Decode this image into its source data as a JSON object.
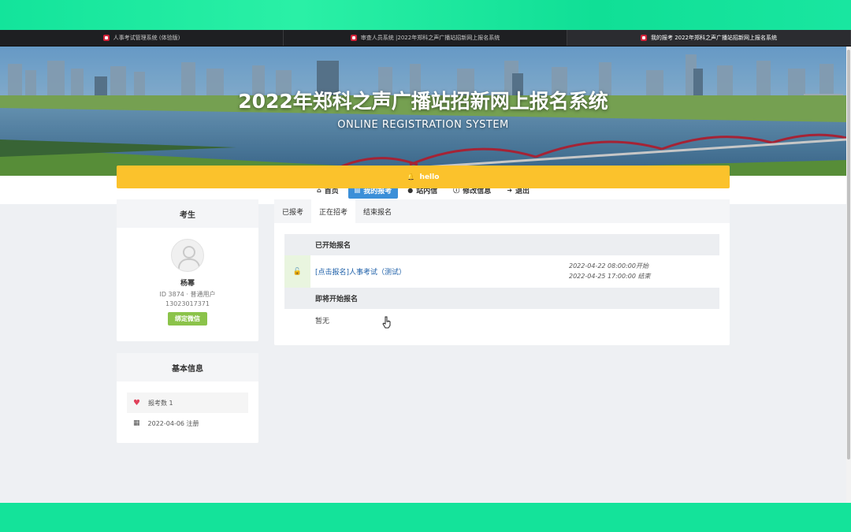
{
  "browser": {
    "tabs": [
      {
        "title": "人事考试管理系统 (体验版)",
        "active": false
      },
      {
        "title": "审查人员系统 |2022年郑科之声广播站招新网上报名系统",
        "active": false
      },
      {
        "title": "我的报考 2022年郑科之声广播站招新网上报名系统",
        "active": true
      }
    ]
  },
  "banner": {
    "title": "2022年郑科之声广播站招新网上报名系统",
    "subtitle": "ONLINE REGISTRATION SYSTEM"
  },
  "nav": [
    {
      "icon": "home-icon",
      "glyph": "⌂",
      "label": "首页",
      "active": false
    },
    {
      "icon": "id-card-icon",
      "glyph": "▤",
      "label": "我的报考",
      "active": true
    },
    {
      "icon": "chat-icon",
      "glyph": "●",
      "label": "站内信",
      "active": false
    },
    {
      "icon": "info-icon",
      "glyph": "ⓘ",
      "label": "修改信息",
      "active": false
    },
    {
      "icon": "logout-icon",
      "glyph": "➜",
      "label": "退出",
      "active": false
    }
  ],
  "notice": {
    "icon": "bell-icon",
    "glyph": "🔔",
    "text": "hello",
    "color": "#fbc22c"
  },
  "user_panel": {
    "heading": "考生",
    "name": "杨幂",
    "id_line": "ID 3874 · 普通用户",
    "phone": "13023017371",
    "bind_button": "绑定微信"
  },
  "info_panel": {
    "heading": "基本信息",
    "count_label": "报考数 1",
    "register_label": "2022-04-06 注册"
  },
  "main_panel": {
    "tabs": [
      {
        "label": "已报考",
        "active": false
      },
      {
        "label": "正在招考",
        "active": true
      },
      {
        "label": "结束报名",
        "active": false
      }
    ],
    "started_heading": "已开始报名",
    "exam_link": "[点击报名]人事考试（测试）",
    "exam_start": "2022-04-22 08:00:00开始",
    "exam_end": "2022-04-25 17:00:00 结束",
    "upcoming_heading": "即将开始报名",
    "upcoming_empty": "暂无"
  },
  "colors": {
    "accent": "#3b8fd8",
    "notice": "#fbc22c",
    "wechat": "#8bc34a",
    "frame": "#14e39a"
  }
}
